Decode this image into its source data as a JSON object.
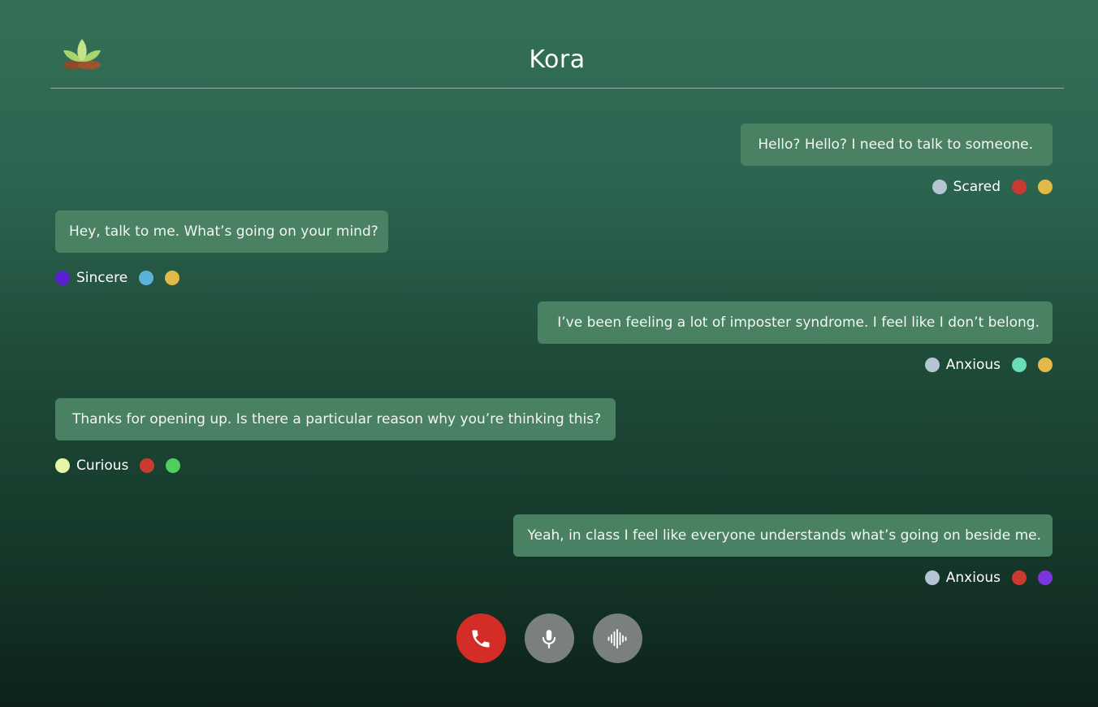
{
  "app": {
    "title": "Kora",
    "logo_icon": "sprout-logo-icon"
  },
  "colors": {
    "background_top": "#336f57",
    "background_bottom": "#0c2219",
    "bubble": "#4a8162",
    "end_call": "#d42d27",
    "control_grey": "#7a817d"
  },
  "messages": [
    {
      "side": "right",
      "text": "Hello? Hello? I need to talk to someone.",
      "emotion": "Scared",
      "dots": [
        "#b5c5d3",
        "#cb3a31",
        "#e3b94a"
      ]
    },
    {
      "side": "left",
      "text": "Hey, talk to me. What’s going on your mind?",
      "emotion": "Sincere",
      "dots": [
        "#5a1fd0",
        "#5ab3d6",
        "#e3b94a"
      ]
    },
    {
      "side": "right",
      "text": "I’ve been feeling a lot of imposter syndrome. I feel like I don’t belong.",
      "emotion": "Anxious",
      "dots": [
        "#b5c5d3",
        "#68ddb6",
        "#e3b94a"
      ]
    },
    {
      "side": "left",
      "text": "Thanks for opening up. Is there a particular reason why you’re thinking this?",
      "emotion": "Curious",
      "dots": [
        "#e4f7a6",
        "#cb3a31",
        "#4fcf5e"
      ]
    },
    {
      "side": "right",
      "text": "Yeah, in class I feel like everyone understands what’s going on beside me.",
      "emotion": "Anxious",
      "dots": [
        "#b5c5d3",
        "#cb3a31",
        "#7a36dc"
      ]
    }
  ],
  "controls": {
    "end_call_icon": "phone-icon",
    "mic_icon": "microphone-icon",
    "voice_icon": "waveform-icon"
  }
}
